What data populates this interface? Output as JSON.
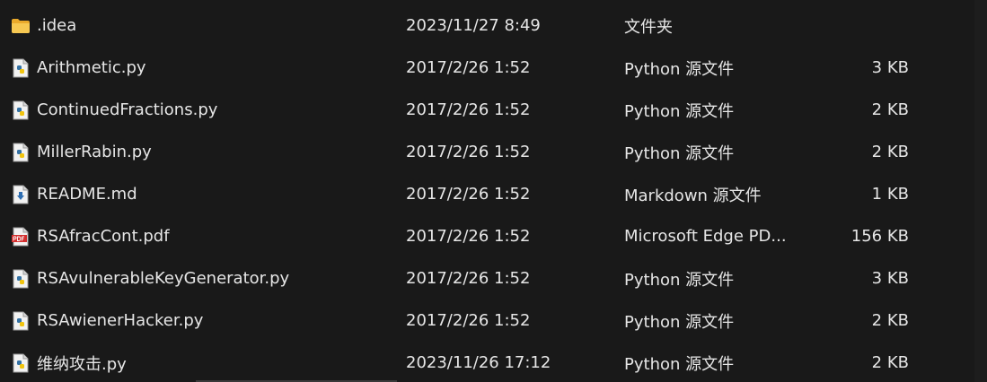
{
  "files": [
    {
      "name": ".idea",
      "date": "2023/11/27 8:49",
      "type": "文件夹",
      "size": "",
      "icon": "folder-icon"
    },
    {
      "name": "Arithmetic.py",
      "date": "2017/2/26 1:52",
      "type": "Python 源文件",
      "size": "3 KB",
      "icon": "python-file-icon"
    },
    {
      "name": "ContinuedFractions.py",
      "date": "2017/2/26 1:52",
      "type": "Python 源文件",
      "size": "2 KB",
      "icon": "python-file-icon"
    },
    {
      "name": "MillerRabin.py",
      "date": "2017/2/26 1:52",
      "type": "Python 源文件",
      "size": "2 KB",
      "icon": "python-file-icon"
    },
    {
      "name": "README.md",
      "date": "2017/2/26 1:52",
      "type": "Markdown 源文件",
      "size": "1 KB",
      "icon": "markdown-file-icon"
    },
    {
      "name": "RSAfracCont.pdf",
      "date": "2017/2/26 1:52",
      "type": "Microsoft Edge PD...",
      "size": "156 KB",
      "icon": "pdf-file-icon"
    },
    {
      "name": "RSAvulnerableKeyGenerator.py",
      "date": "2017/2/26 1:52",
      "type": "Python 源文件",
      "size": "3 KB",
      "icon": "python-file-icon"
    },
    {
      "name": "RSAwienerHacker.py",
      "date": "2017/2/26 1:52",
      "type": "Python 源文件",
      "size": "2 KB",
      "icon": "python-file-icon"
    },
    {
      "name": "维纳攻击.py",
      "date": "2023/11/26 17:12",
      "type": "Python 源文件",
      "size": "2 KB",
      "icon": "python-file-icon"
    }
  ],
  "colors": {
    "background": "#191919",
    "text": "#e6e6e6",
    "folder": "#f4c24d",
    "python_blue": "#3572a5",
    "pdf_red": "#d32f2f"
  }
}
